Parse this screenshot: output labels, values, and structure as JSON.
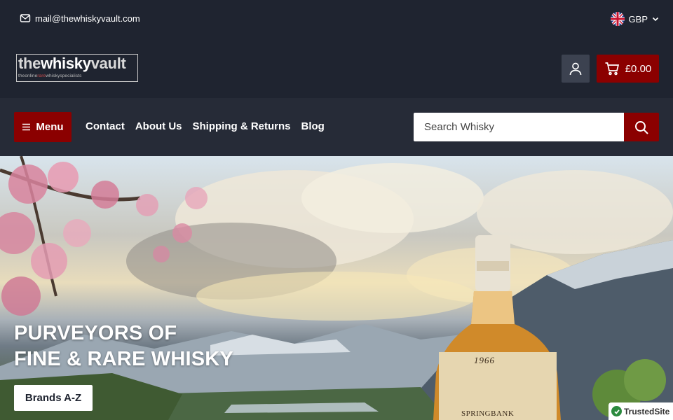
{
  "topbar": {
    "email": "mail@thewhiskyvault.com",
    "currency": "GBP"
  },
  "header": {
    "logo": {
      "text_pre": "the",
      "text_mid": "whisky",
      "text_post": "vault",
      "tagline_a": "theonline",
      "tagline_b": "rare",
      "tagline_c": "whiskyspecialists"
    },
    "cart_total": "£0.00"
  },
  "nav": {
    "menu_label": "Menu",
    "links": [
      "Contact",
      "About Us",
      "Shipping & Returns",
      "Blog"
    ],
    "search_placeholder": "Search Whisky"
  },
  "hero": {
    "title_line1": "PURVEYORS OF",
    "title_line2": "FINE & RARE WHISKY",
    "button_label": "Brands A-Z",
    "bottle_year": "1966",
    "bottle_brand": "SPRINGBANK"
  },
  "badge": {
    "label": "TrustedSite"
  },
  "colors": {
    "accent": "#8b0000",
    "background": "#1f2430",
    "nav_background": "#262b37"
  }
}
